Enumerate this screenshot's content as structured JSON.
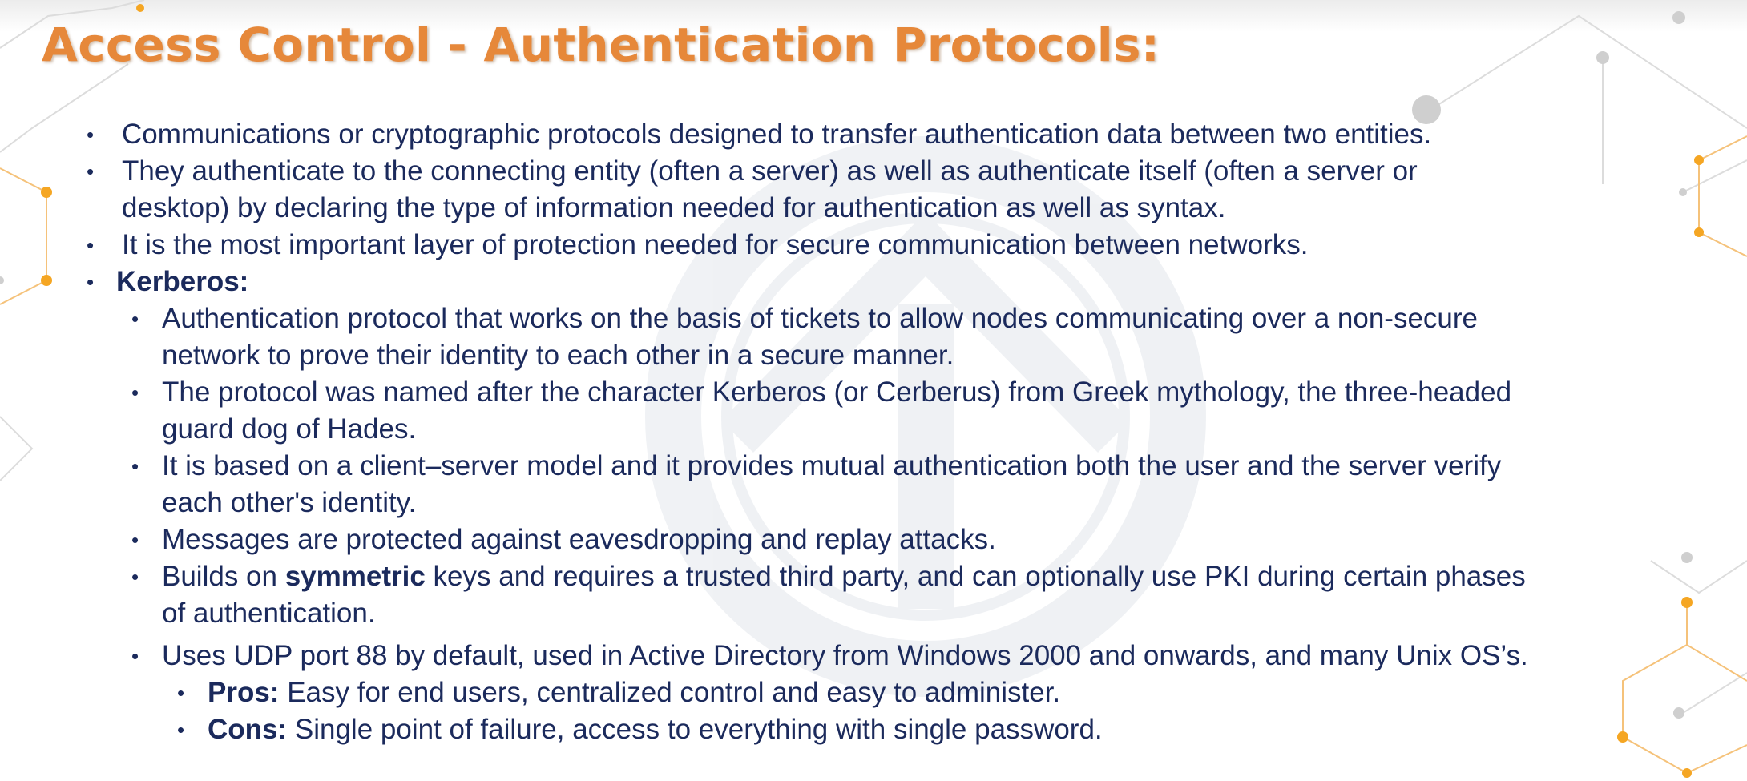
{
  "slide": {
    "title": "Access Control - Authentication Protocols:",
    "bullet_glyph": "•",
    "items": [
      {
        "text": "Communications or cryptographic protocols designed to transfer authentication data between two entities."
      },
      {
        "line1": "They authenticate to the connecting entity (often a server) as well as authenticate itself (often a server or",
        "line2": "desktop) by declaring the type of information needed for authentication as well as syntax."
      },
      {
        "text": "It is the most important layer of protection needed for secure communication between networks."
      },
      {
        "heading": "Kerberos:"
      }
    ],
    "kerberos": [
      {
        "line1": "Authentication protocol that works on the basis of tickets to allow nodes communicating over a non-secure",
        "line2": "network to prove their identity to each other in a secure manner."
      },
      {
        "line1": "The protocol was named after the character Kerberos (or Cerberus) from Greek mythology, the three-headed",
        "line2": "guard dog of Hades."
      },
      {
        "line1": "It is based on a client–server model and it provides mutual authentication both the user and the server verify",
        "line2": "each other's identity."
      },
      {
        "text": "Messages are protected against eavesdropping and replay attacks."
      },
      {
        "pre": "Builds on ",
        "bold": "symmetric",
        "post": " keys and requires a trusted third party, and can optionally use PKI during certain phases",
        "line2": "of authentication."
      },
      {
        "text": "Uses UDP port 88 by default, used in Active Directory from Windows 2000 and onwards, and many Unix OS’s."
      }
    ],
    "pros_cons": [
      {
        "label": "Pros:",
        "text": " Easy for end users, centralized control and easy to administer."
      },
      {
        "label": "Cons:",
        "text": " Single point of failure, access to everything with single password."
      }
    ]
  },
  "colors": {
    "title": "#e6883a",
    "body_text": "#1b2a5c",
    "accent_orange": "#f5a623",
    "watermark": "#8b9bb0"
  }
}
